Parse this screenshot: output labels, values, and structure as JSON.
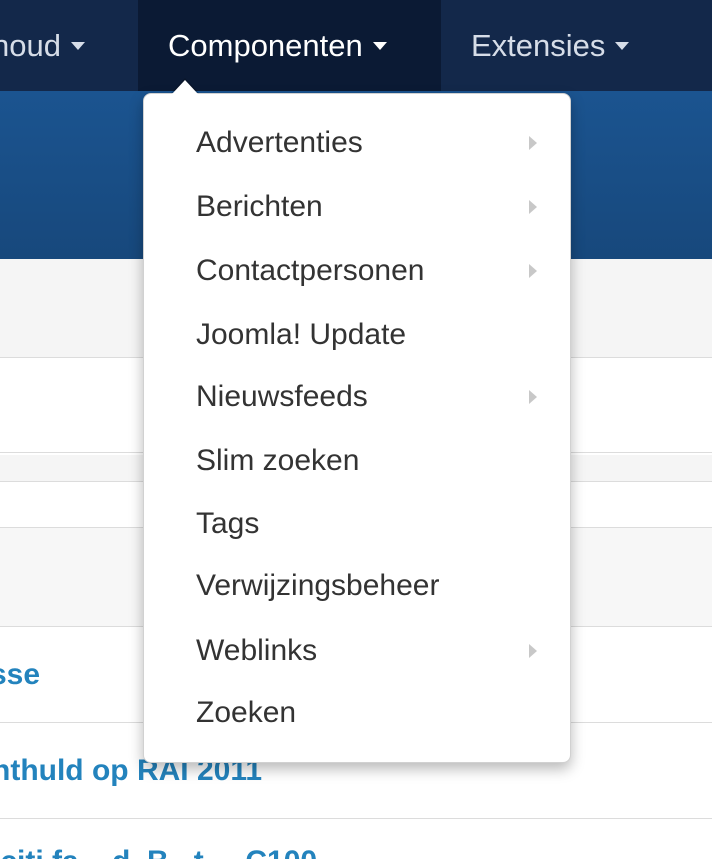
{
  "nav": {
    "items": [
      {
        "label": "noud"
      },
      {
        "label": "Componenten",
        "active": true
      },
      {
        "label": "Extensies"
      }
    ]
  },
  "background": {
    "links": [
      {
        "text": "sse"
      },
      {
        "text": "nthuld op RAI 2011"
      },
      {
        "text": "iciti fa... d. B...t.... C100"
      }
    ]
  },
  "dropdown": {
    "items": [
      {
        "label": "Advertenties",
        "submenu": true
      },
      {
        "label": "Berichten",
        "submenu": true
      },
      {
        "label": "Contactpersonen",
        "submenu": true
      },
      {
        "label": "Joomla! Update",
        "submenu": false
      },
      {
        "label": "Nieuwsfeeds",
        "submenu": true
      },
      {
        "label": "Slim zoeken",
        "submenu": false
      },
      {
        "label": "Tags",
        "submenu": false
      },
      {
        "label": "Verwijzingsbeheer",
        "submenu": false
      },
      {
        "label": "Weblinks",
        "submenu": true
      },
      {
        "label": "Zoeken",
        "submenu": false
      }
    ]
  },
  "colors": {
    "navbar": "#13284a",
    "subheader": "#1b5490",
    "link": "#2383bd",
    "menu_text": "#333333"
  },
  "icons": {
    "nav_caret": "caret-down-icon",
    "submenu": "caret-right-icon"
  }
}
